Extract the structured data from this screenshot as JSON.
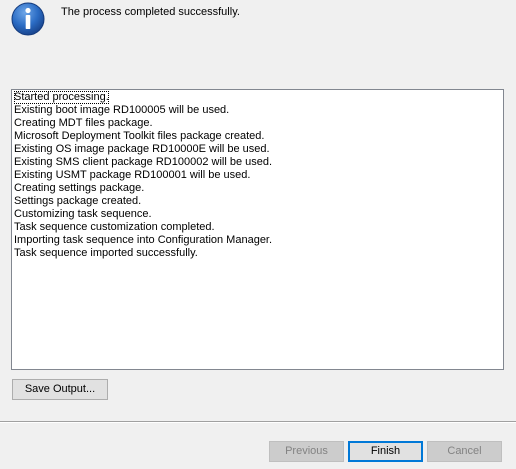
{
  "header": {
    "icon": "information-icon",
    "message": "The process completed successfully."
  },
  "log": {
    "lines": [
      "Started processing.",
      "Existing boot image RD100005 will be used.",
      "Creating MDT files package.",
      "Microsoft Deployment Toolkit files package created.",
      "Existing OS image package RD10000E will be used.",
      "Existing SMS client package RD100002 will be used.",
      "Existing USMT package RD100001 will be used.",
      "Creating settings package.",
      "Settings package created.",
      "Customizing task sequence.",
      "Task sequence customization completed.",
      "Importing task sequence into Configuration Manager.",
      "Task sequence imported successfully."
    ]
  },
  "save_output_label": "Save Output...",
  "footer": {
    "previous_label": "Previous",
    "finish_label": "Finish",
    "cancel_label": "Cancel",
    "previous_enabled": false,
    "finish_enabled": true,
    "cancel_enabled": false
  },
  "colors": {
    "background": "#f0f0f0",
    "icon_blue": "#1f5fb0",
    "default_button_border": "#0078d7",
    "disabled_text": "#838383"
  }
}
